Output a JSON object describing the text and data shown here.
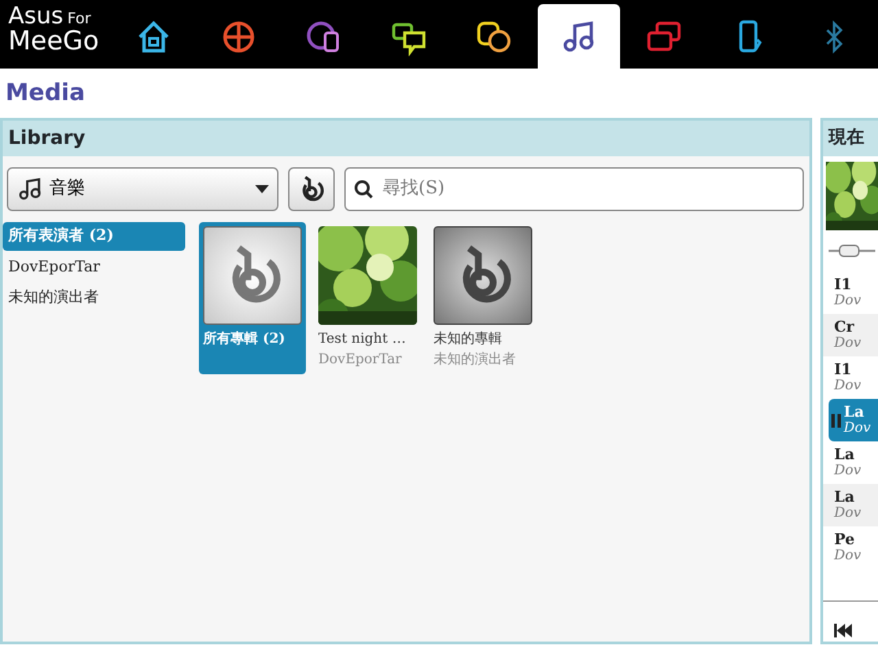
{
  "brand": {
    "name": "Asus",
    "suffix": "For",
    "product": "MeeGo"
  },
  "app_tabs": [
    {
      "kind": "home",
      "selected": false
    },
    {
      "kind": "grid",
      "selected": false
    },
    {
      "kind": "globe",
      "selected": false
    },
    {
      "kind": "chat",
      "selected": false
    },
    {
      "kind": "people",
      "selected": false
    },
    {
      "kind": "music",
      "selected": true
    },
    {
      "kind": "windows",
      "selected": false
    },
    {
      "kind": "phone",
      "selected": false
    },
    {
      "kind": "bluetooth",
      "selected": false
    }
  ],
  "page_title": "Media",
  "library": {
    "title": "Library",
    "source_select": {
      "value": "音樂"
    },
    "search": {
      "placeholder": "尋找(S)"
    },
    "artists": [
      {
        "label": "所有表演者 (2)",
        "selected": true
      },
      {
        "label": "DovEporTar",
        "selected": false
      },
      {
        "label": "未知的演出者",
        "selected": false
      }
    ],
    "albums": [
      {
        "kind": "placeholder",
        "title": "所有專輯 (2)",
        "selected": true
      },
      {
        "kind": "picture",
        "title": "Test night …",
        "artist": "DovEporTar",
        "selected": false
      },
      {
        "kind": "placeholder-dark",
        "title": "未知的專輯",
        "artist": "未知的演出者",
        "selected": false
      }
    ]
  },
  "now_playing": {
    "title": "現在",
    "tracks": [
      {
        "title": "I1",
        "artist": "Dov",
        "playing": false
      },
      {
        "title": "Cr",
        "artist": "Dov",
        "playing": false
      },
      {
        "title": "I1",
        "artist": "Dov",
        "playing": false
      },
      {
        "title": "La",
        "artist": "Dov",
        "playing": true
      },
      {
        "title": "La",
        "artist": "Dov",
        "playing": false
      },
      {
        "title": "La",
        "artist": "Dov",
        "playing": false
      },
      {
        "title": "Pe",
        "artist": "Dov",
        "playing": false
      }
    ]
  }
}
